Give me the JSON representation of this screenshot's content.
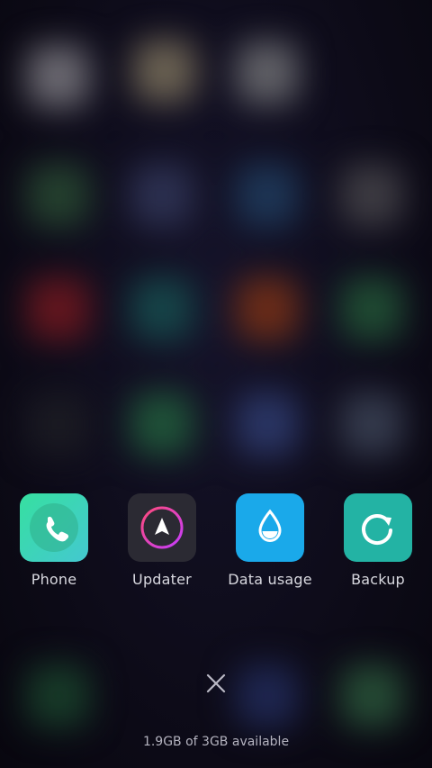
{
  "apps": [
    {
      "label": "Phone",
      "icon": "phone-icon",
      "color": "#2fd39a"
    },
    {
      "label": "Updater",
      "icon": "updater-arrow-icon",
      "color": "#2b2a33"
    },
    {
      "label": "Data usage",
      "icon": "water-drop-icon",
      "color": "#1aa9ea"
    },
    {
      "label": "Backup",
      "icon": "backup-refresh-icon",
      "color": "#23b3a4"
    }
  ],
  "close_icon": "close-icon",
  "storage": {
    "text": "1.9GB of 3GB available"
  }
}
